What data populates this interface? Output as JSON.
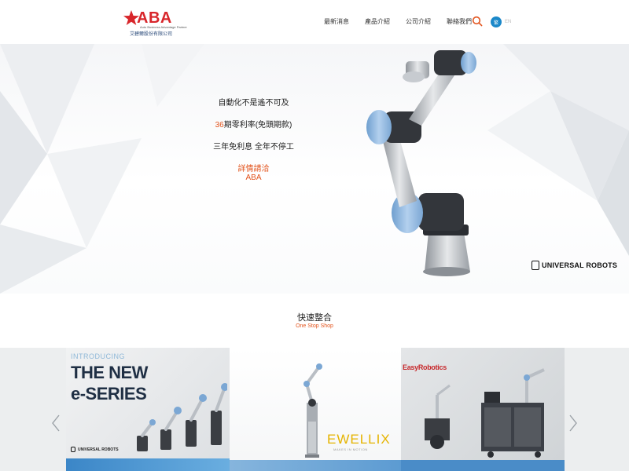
{
  "header": {
    "logo_text": "ABA",
    "logo_tagline": "Auto Business Advantage Partner",
    "logo_company": "艾碧爾股份有限公司",
    "nav": [
      "最新消息",
      "產品介紹",
      "公司介紹",
      "聯絡我們"
    ],
    "lang_zh": "繁",
    "lang_en": "EN"
  },
  "hero": {
    "line1": "自動化不是遙不可及",
    "line2_number": "36",
    "line2_rest": "期零利率(免頭期款)",
    "line3": "三年免利息 全年不停工",
    "contact_line1": "詳情請洽",
    "contact_line2": "ABA",
    "badge": "UNIVERSAL ROBOTS"
  },
  "section": {
    "title": "快速整合",
    "subtitle": "One Stop Shop"
  },
  "carousel": {
    "cards": [
      {
        "intro": "INTRODUCING",
        "title_line1": "THE NEW",
        "title_line2": "e-SERIES",
        "brand": "UNIVERSAL ROBOTS"
      },
      {
        "brand": "EWELLIX",
        "slogan": "MAKES IN MOTION"
      },
      {
        "brand": "EasyRobotics"
      }
    ]
  },
  "colors": {
    "accent": "#e2531c",
    "brand_red": "#d8262b",
    "lang_blue": "#1b88c9",
    "ur_blue": "#8fb3d9"
  },
  "icons": [
    "star-logo-icon",
    "search-icon",
    "chevron-left-icon",
    "chevron-right-icon",
    "ur-logo-icon"
  ]
}
